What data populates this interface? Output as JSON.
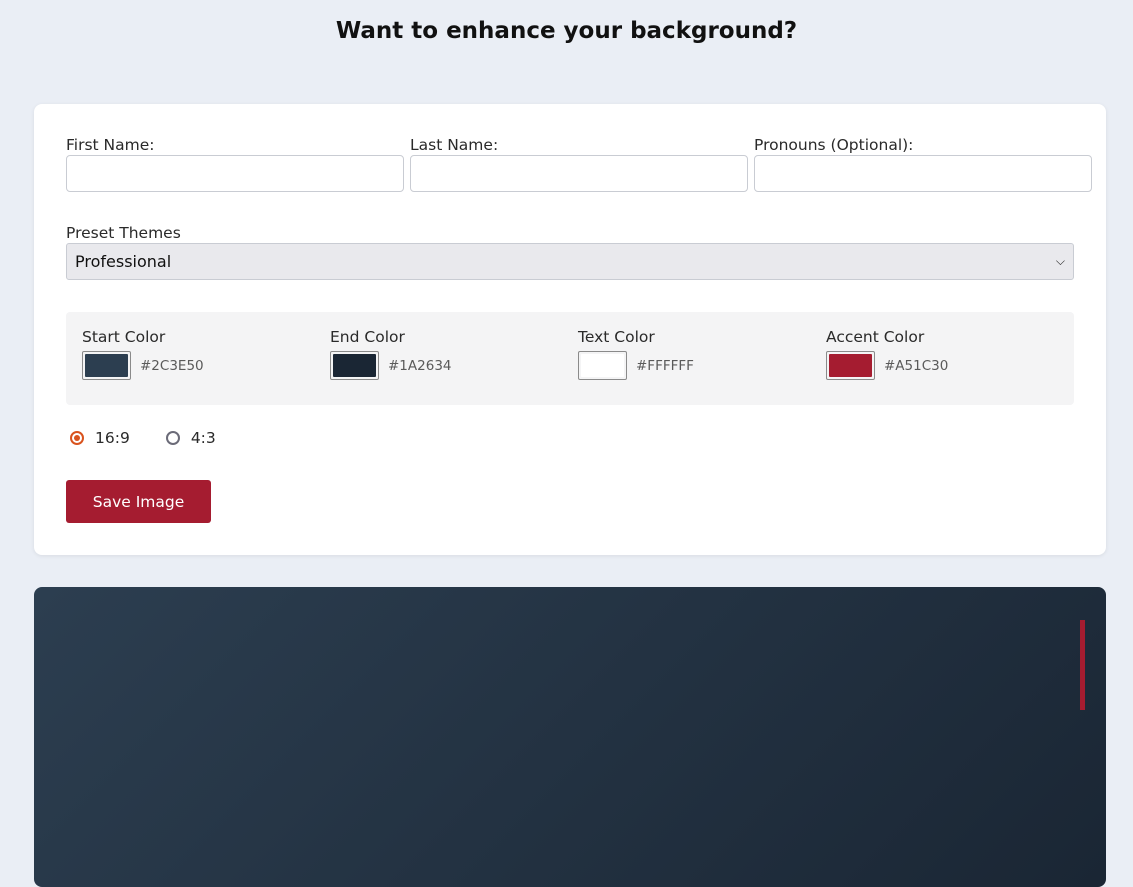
{
  "header": {
    "title": "Want to enhance your background?"
  },
  "form": {
    "first_name": {
      "label": "First Name:",
      "value": ""
    },
    "last_name": {
      "label": "Last Name:",
      "value": ""
    },
    "pronouns": {
      "label": "Pronouns (Optional):",
      "value": ""
    },
    "preset": {
      "label": "Preset Themes",
      "selected": "Professional"
    },
    "colors": [
      {
        "label": "Start Color",
        "hex": "#2C3E50",
        "value": "#2c3e50"
      },
      {
        "label": "End Color",
        "hex": "#1A2634",
        "value": "#1a2634"
      },
      {
        "label": "Text Color",
        "hex": "#FFFFFF",
        "value": "#ffffff"
      },
      {
        "label": "Accent Color",
        "hex": "#A51C30",
        "value": "#a51c30"
      }
    ],
    "aspect_ratios": [
      {
        "label": "16:9",
        "checked": true
      },
      {
        "label": "4:3",
        "checked": false
      }
    ],
    "save_label": "Save Image"
  },
  "preview": {
    "gradient_start": "#2c3e50",
    "gradient_end": "#1a2634",
    "accent": "#a51c30"
  }
}
